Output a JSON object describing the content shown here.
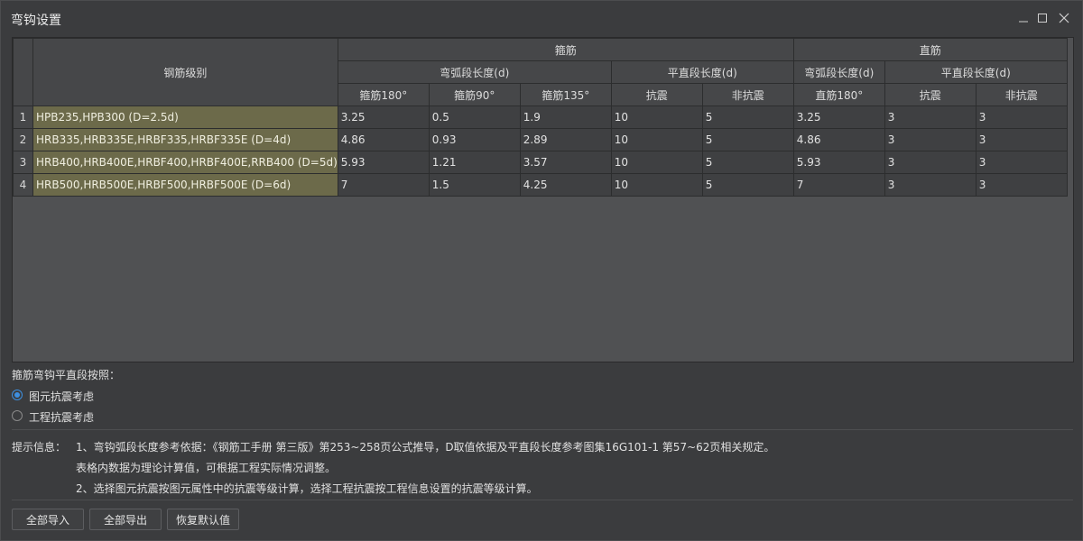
{
  "window": {
    "title": "弯钩设置"
  },
  "table": {
    "header": {
      "grade": "钢筋级别",
      "stirrup": "箍筋",
      "straight": "直筋",
      "stirrup_arc": "弯弧段长度(d)",
      "stirrup_flat": "平直段长度(d)",
      "straight_arc": "弯弧段长度(d)",
      "straight_flat": "平直段长度(d)",
      "cols": [
        "箍筋180°",
        "箍筋90°",
        "箍筋135°",
        "抗震",
        "非抗震",
        "直筋180°",
        "抗震",
        "非抗震"
      ]
    },
    "rows": [
      {
        "num": "1",
        "grade": "HPB235,HPB300 (D=2.5d)",
        "cells": [
          "3.25",
          "0.5",
          "1.9",
          "10",
          "5",
          "3.25",
          "3",
          "3"
        ]
      },
      {
        "num": "2",
        "grade": "HRB335,HRB335E,HRBF335,HRBF335E (D=4d)",
        "cells": [
          "4.86",
          "0.93",
          "2.89",
          "10",
          "5",
          "4.86",
          "3",
          "3"
        ]
      },
      {
        "num": "3",
        "grade": "HRB400,HRB400E,HRBF400,HRBF400E,RRB400 (D=5d)",
        "cells": [
          "5.93",
          "1.21",
          "3.57",
          "10",
          "5",
          "5.93",
          "3",
          "3"
        ]
      },
      {
        "num": "4",
        "grade": "HRB500,HRB500E,HRBF500,HRBF500E (D=6d)",
        "cells": [
          "7",
          "1.5",
          "4.25",
          "10",
          "5",
          "7",
          "3",
          "3"
        ]
      }
    ]
  },
  "options": {
    "label": "箍筋弯钩平直段按照：",
    "radio1": {
      "label": "图元抗震考虑",
      "checked": true
    },
    "radio2": {
      "label": "工程抗震考虑",
      "checked": false
    }
  },
  "hints": {
    "label": "提示信息：",
    "line1": "1、弯钩弧段长度参考依据：《钢筋工手册 第三版》第253~258页公式推导，D取值依据及平直段长度参考图集16G101-1 第57~62页相关规定。",
    "line2": "表格内数据为理论计算值，可根据工程实际情况调整。",
    "line3": "2、选择图元抗震按图元属性中的抗震等级计算，选择工程抗震按工程信息设置的抗震等级计算。"
  },
  "buttons": {
    "import_all": "全部导入",
    "export_all": "全部导出",
    "restore_default": "恢复默认值"
  },
  "colors": {
    "background": "#3b3c3e",
    "grade_cell": "#6c6a4a",
    "radio_accent": "#3d8fe0"
  }
}
